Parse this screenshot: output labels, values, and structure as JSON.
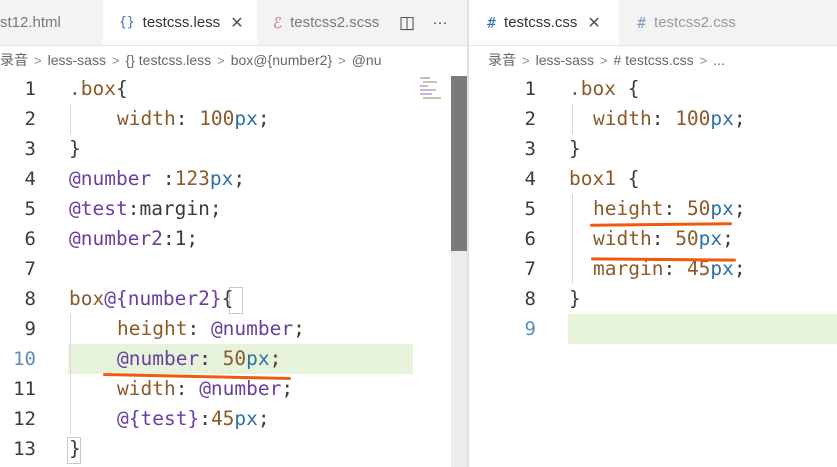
{
  "left_pane": {
    "tabs": [
      {
        "icon": "",
        "label": "st12.html",
        "active": false
      },
      {
        "icon": "{}",
        "label": "testcss.less",
        "active": true,
        "close": "✕"
      },
      {
        "icon": "ℰ",
        "label": "testcss2.scss",
        "active": false
      }
    ],
    "breadcrumb": [
      "录音",
      "less-sass",
      "{} testcss.less",
      "box@{number2}",
      "@nu"
    ],
    "lines": [
      {
        "n": "1"
      },
      {
        "n": "2"
      },
      {
        "n": "3"
      },
      {
        "n": "4"
      },
      {
        "n": "5"
      },
      {
        "n": "6"
      },
      {
        "n": "7"
      },
      {
        "n": "8"
      },
      {
        "n": "9"
      },
      {
        "n": "10"
      },
      {
        "n": "11"
      },
      {
        "n": "12"
      },
      {
        "n": "13"
      }
    ],
    "code": {
      "l1a": ".box",
      "l1b": "{",
      "l2a": "width",
      "l2b": ": ",
      "l2c": "100",
      "l2d": "px",
      "l2e": ";",
      "l3a": "}",
      "l4a": "@number",
      "l4b": " :",
      "l4c": "123",
      "l4d": "px",
      "l4e": ";",
      "l5a": "@test",
      "l5b": ":",
      "l5c": "margin",
      "l5d": ";",
      "l6a": "@number2",
      "l6b": ":",
      "l6c": "1",
      "l6d": ";",
      "l8a": "box",
      "l8b": "@{number2}",
      "l8c": "{",
      "l9a": "height",
      "l9b": ": ",
      "l9c": "@number",
      "l9d": ";",
      "l10a": "@number",
      "l10b": ": ",
      "l10c": "50",
      "l10d": "px",
      "l10e": ";",
      "l11a": "width",
      "l11b": ": ",
      "l11c": "@number",
      "l11d": ";",
      "l12a": "@{test}",
      "l12b": ":",
      "l12c": "45",
      "l12d": "px",
      "l12e": ";",
      "l13a": "}"
    }
  },
  "right_pane": {
    "tabs": [
      {
        "icon": "#",
        "label": "testcss.css",
        "active": true,
        "close": "✕"
      },
      {
        "icon": "#",
        "label": "testcss2.css",
        "active": false
      }
    ],
    "breadcrumb": [
      "录音",
      "less-sass",
      "# testcss.css",
      "..."
    ],
    "lines": [
      {
        "n": "1"
      },
      {
        "n": "2"
      },
      {
        "n": "3"
      },
      {
        "n": "4"
      },
      {
        "n": "5"
      },
      {
        "n": "6"
      },
      {
        "n": "7"
      },
      {
        "n": "8"
      },
      {
        "n": "9"
      }
    ],
    "code": {
      "l1a": ".box",
      "l1b": " {",
      "l2a": "width",
      "l2b": ": ",
      "l2c": "100",
      "l2d": "px",
      "l2e": ";",
      "l3a": "}",
      "l4a": "box1",
      "l4b": " {",
      "l5a": "height",
      "l5b": ": ",
      "l5c": "50",
      "l5d": "px",
      "l5e": ";",
      "l6a": "width",
      "l6b": ": ",
      "l6c": "50",
      "l6d": "px",
      "l6e": ";",
      "l7a": "margin",
      "l7b": ": ",
      "l7c": "45",
      "l7d": "px",
      "l7e": ";",
      "l8a": "}"
    }
  },
  "toolbar": {
    "split_icon": "◫",
    "more_icon": "···"
  },
  "colors": {
    "highlight": "#e6f3da",
    "underline": "#f05a10",
    "accent_line_number": "#5a8fbd"
  }
}
